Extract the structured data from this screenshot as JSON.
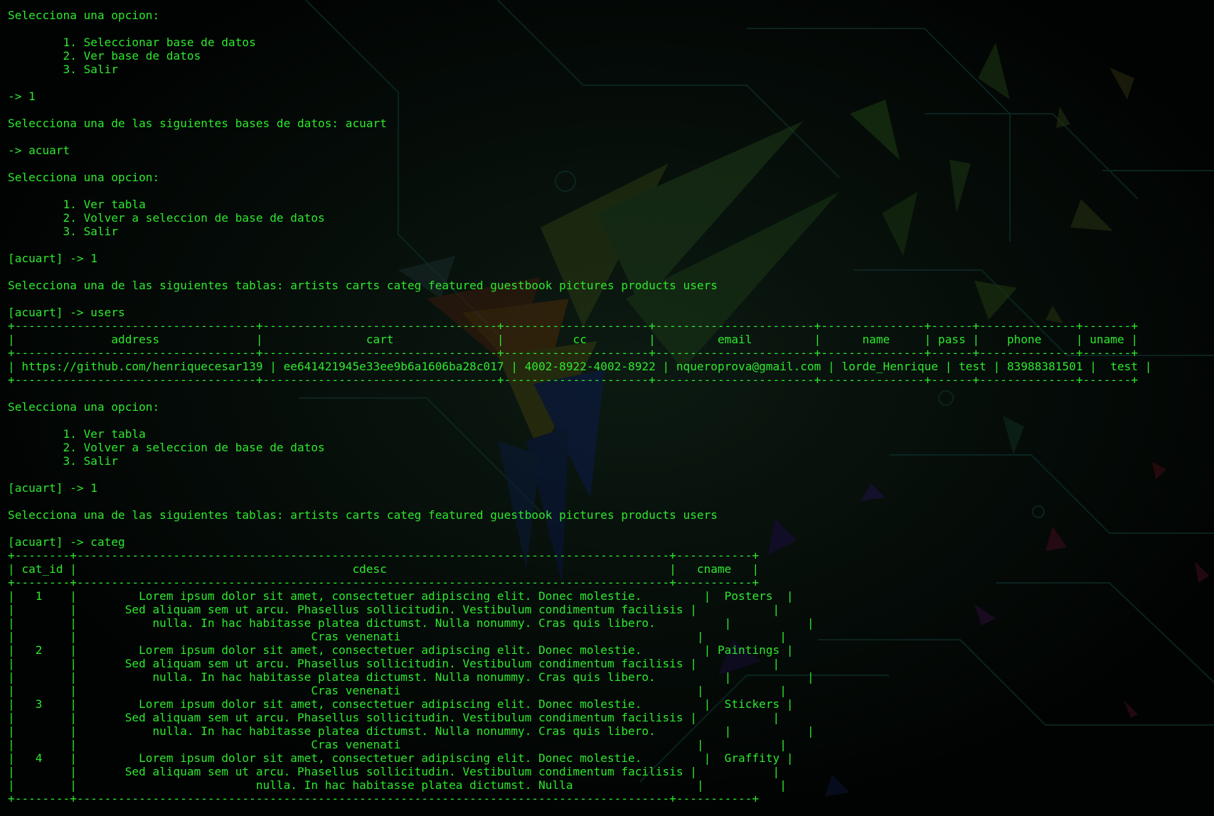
{
  "colors": {
    "background": "#020403",
    "terminal_text": "#2ee82e"
  },
  "terminal": {
    "lines": [
      "Selecciona una opcion:",
      "",
      "        1. Seleccionar base de datos",
      "        2. Ver base de datos",
      "        3. Salir",
      "",
      "-> 1",
      "",
      "Selecciona una de las siguientes bases de datos: acuart",
      "",
      "-> acuart",
      "",
      "Selecciona una opcion:",
      "",
      "        1. Ver tabla",
      "        2. Volver a seleccion de base de datos",
      "        3. Salir",
      "",
      "[acuart] -> 1",
      "",
      "Selecciona una de las siguientes tablas: artists carts categ featured guestbook pictures products users",
      "",
      "[acuart] -> users",
      "+-----------------------------------+----------------------------------+---------------------+-----------------------+---------------+------+--------------+-------+",
      "|              address              |               cart               |          cc         |         email         |      name     | pass |    phone     | uname |",
      "+-----------------------------------+----------------------------------+---------------------+-----------------------+---------------+------+--------------+-------+",
      "| https://github.com/henriquecesar139 | ee641421945e33ee9b6a1606ba28c017 | 4002-8922-4002-8922 | nqueroprova@gmail.com | lorde_Henrique | test | 83988381501 |  test |",
      "+-----------------------------------+----------------------------------+---------------------+-----------------------+---------------+------+--------------+-------+",
      "",
      "Selecciona una opcion:",
      "",
      "        1. Ver tabla",
      "        2. Volver a seleccion de base de datos",
      "        3. Salir",
      "",
      "[acuart] -> 1",
      "",
      "Selecciona una de las siguientes tablas: artists carts categ featured guestbook pictures products users",
      "",
      "[acuart] -> categ",
      "+--------+--------------------------------------------------------------------------------------+-----------+",
      "| cat_id |                                        cdesc                                         |   cname   |",
      "+--------+--------------------------------------------------------------------------------------+-----------+",
      "|   1    |         Lorem ipsum dolor sit amet, consectetuer adipiscing elit. Donec molestie.         |  Posters  |",
      "|        |       Sed aliquam sem ut arcu. Phasellus sollicitudin. Vestibulum condimentum facilisis |           |",
      "|        |           nulla. In hac habitasse platea dictumst. Nulla nonummy. Cras quis libero.          |           |",
      "|        |                                  Cras venenati                                           |           |",
      "|   2    |         Lorem ipsum dolor sit amet, consectetuer adipiscing elit. Donec molestie.         | Paintings |",
      "|        |       Sed aliquam sem ut arcu. Phasellus sollicitudin. Vestibulum condimentum facilisis |           |",
      "|        |           nulla. In hac habitasse platea dictumst. Nulla nonummy. Cras quis libero.          |           |",
      "|        |                                  Cras venenati                                           |           |",
      "|   3    |         Lorem ipsum dolor sit amet, consectetuer adipiscing elit. Donec molestie.         |  Stickers |",
      "|        |       Sed aliquam sem ut arcu. Phasellus sollicitudin. Vestibulum condimentum facilisis |           |",
      "|        |           nulla. In hac habitasse platea dictumst. Nulla nonummy. Cras quis libero.          |           |",
      "|        |                                  Cras venenati                                           |           |",
      "|   4    |         Lorem ipsum dolor sit amet, consectetuer adipiscing elit. Donec molestie.         |  Graffity |",
      "|        |       Sed aliquam sem ut arcu. Phasellus sollicitudin. Vestibulum condimentum facilisis |           |",
      "|        |                          nulla. In hac habitasse platea dictumst. Nulla                  |           |",
      "+--------+--------------------------------------------------------------------------------------+-----------+"
    ]
  }
}
